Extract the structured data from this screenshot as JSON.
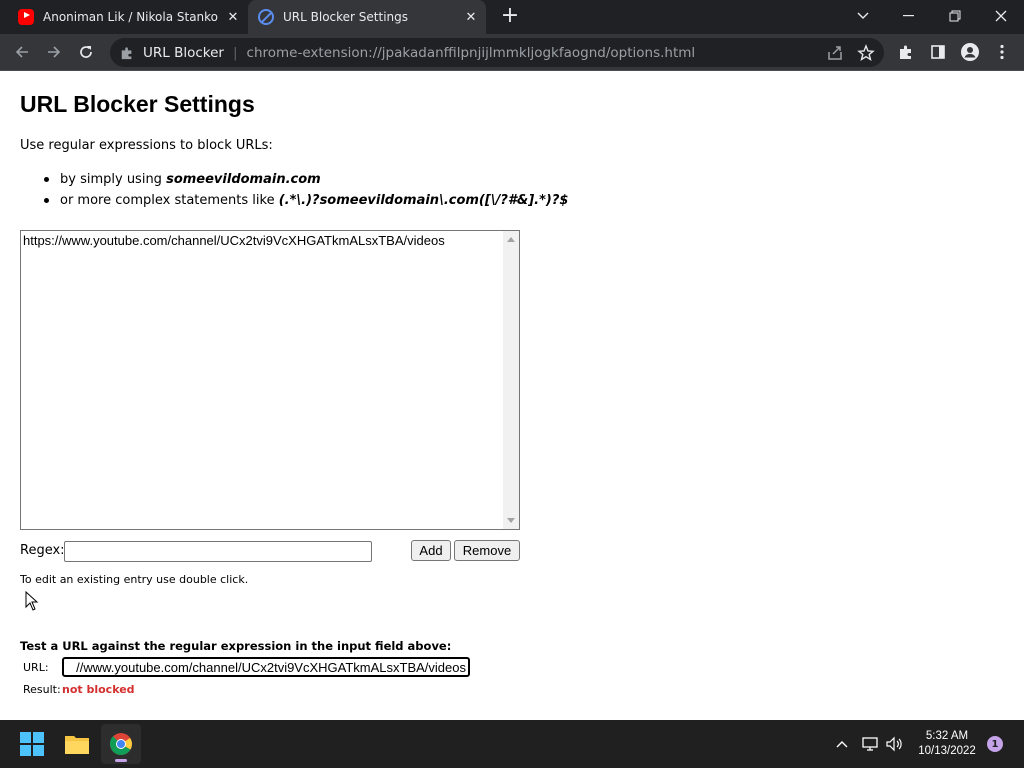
{
  "browser": {
    "tabs": [
      {
        "title": "Anoniman Lik / Nikola Stankovic",
        "favicon": "youtube-icon",
        "active": false
      },
      {
        "title": "URL Blocker Settings",
        "favicon": "url-blocker-icon",
        "active": true
      }
    ],
    "omnibox": {
      "site_name": "URL Blocker",
      "url": "chrome-extension://jpakadanffilpnjijlmmkljogkfaognd/options.html"
    }
  },
  "page": {
    "heading": "URL Blocker Settings",
    "intro": "Use regular expressions to block URLs:",
    "bullet1_prefix": "by simply using ",
    "bullet1_example": "someevildomain.com",
    "bullet2_prefix": "or more complex statements like ",
    "bullet2_example": "(.*\\.)?someevildomain\\.com([\\/?#&].*)?$",
    "entries": [
      "https://www.youtube.com/channel/UCx2tvi9VcXHGATkmALsxTBA/videos"
    ],
    "regex_label": "Regex:",
    "regex_value": "",
    "add_label": "Add",
    "remove_label": "Remove",
    "hint": "To edit an existing entry use double click.",
    "test_title": "Test a URL against the regular expression in the input field above:",
    "url_label": "URL:",
    "url_value": "//www.youtube.com/channel/UCx2tvi9VcXHGATkmALsxTBA/videos",
    "result_label": "Result:",
    "result_value": "not blocked"
  },
  "taskbar": {
    "time": "5:32 AM",
    "date": "10/13/2022",
    "notification_count": "1"
  },
  "colors": {
    "titlebar": "#202124",
    "toolbar": "#35363a",
    "result_red": "#d32f2f",
    "taskbar": "#202020"
  }
}
